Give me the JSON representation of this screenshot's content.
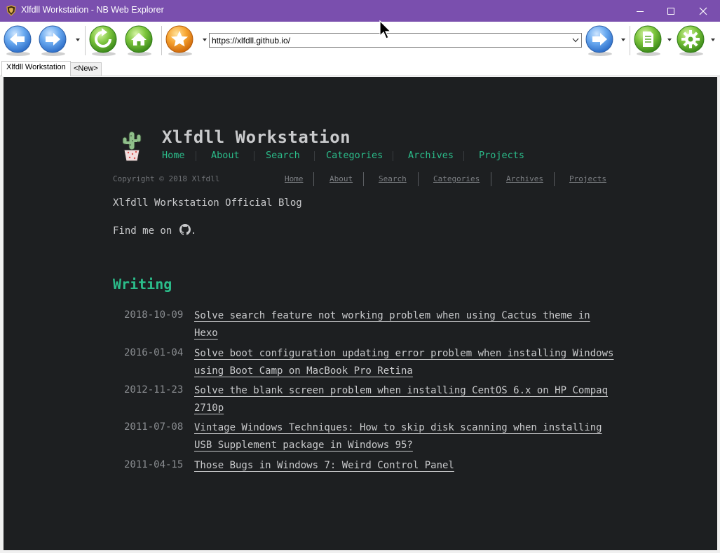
{
  "window": {
    "title": "Xlfdll Workstation - NB Web Explorer",
    "icon": "shield-emblem-icon",
    "controls": [
      "minimize-icon",
      "maximize-icon",
      "close-icon"
    ]
  },
  "toolbar": {
    "buttons": [
      "back-icon",
      "forward-icon",
      "refresh-icon",
      "home-icon",
      "favorites-star-icon",
      "go-icon",
      "page-icon",
      "settings-gear-icon"
    ],
    "address": {
      "value": "https://xlfdll.github.io/"
    }
  },
  "tabs": [
    {
      "label": "Xlfdll Workstation",
      "active": true
    },
    {
      "label": "<New>",
      "active": false
    }
  ],
  "site": {
    "title": "Xlfdll Workstation",
    "logo": "cactus-logo-icon",
    "nav": [
      "Home",
      "About",
      "Search",
      "Categories",
      "Archives",
      "Projects"
    ],
    "copyright": "Copyright © 2018 Xlfdll",
    "subnav": [
      "Home",
      "About",
      "Search",
      "Categories",
      "Archives",
      "Projects"
    ],
    "tagline": "Xlfdll Workstation Official Blog",
    "findme": "Find me on",
    "findme_suffix": ".",
    "github_icon": "github-icon",
    "section_title": "Writing",
    "posts": [
      {
        "date": "2018-10-09",
        "title": "Solve search feature not working problem when using Cactus theme in Hexo"
      },
      {
        "date": "2016-01-04",
        "title": "Solve boot configuration updating error problem when installing Windows using Boot Camp on MacBook Pro Retina"
      },
      {
        "date": "2012-11-23",
        "title": "Solve the blank screen problem when installing CentOS 6.x on HP Compaq 2710p"
      },
      {
        "date": "2011-07-08",
        "title": "Vintage Windows Techniques: How to skip disk scanning when installing USB Supplement package in Windows 95?"
      },
      {
        "date": "2011-04-15",
        "title": "Those Bugs in Windows 7: Weird Control Panel"
      }
    ]
  },
  "colors": {
    "titlebar": "#7a4fae",
    "page_bg": "#1d1f21",
    "accent": "#2bbc8a",
    "text": "#c9cacc"
  }
}
